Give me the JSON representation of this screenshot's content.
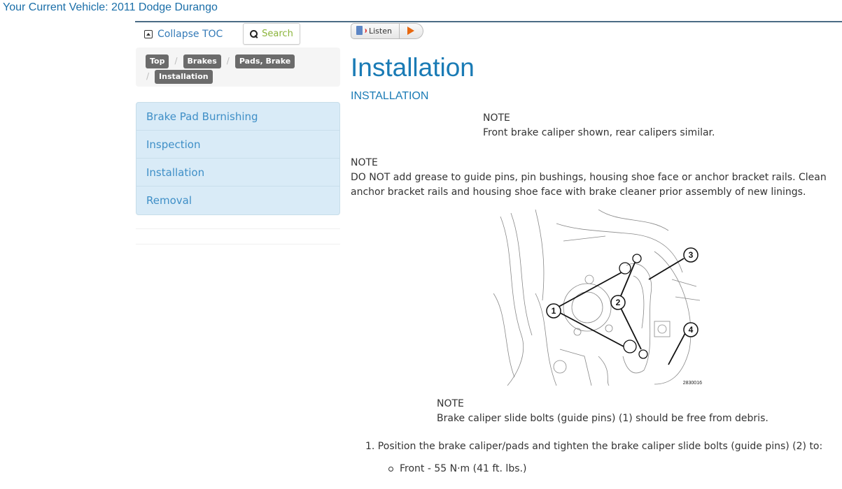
{
  "header": {
    "vehicle_title": "Your Current Vehicle: 2011 Dodge Durango"
  },
  "sidebar": {
    "collapse_toc_label": "Collapse TOC",
    "search_label": "Search",
    "breadcrumb": [
      {
        "label": "Top"
      },
      {
        "label": "Brakes"
      },
      {
        "label": "Pads, Brake"
      },
      {
        "label": "Installation"
      }
    ],
    "breadcrumb_separator": "/",
    "toc_items": [
      {
        "label": "Brake Pad Burnishing"
      },
      {
        "label": "Inspection"
      },
      {
        "label": "Installation"
      },
      {
        "label": "Removal"
      }
    ]
  },
  "main": {
    "listen_label": "Listen",
    "page_title": "Installation",
    "section_title": "INSTALLATION",
    "notes": [
      {
        "heading": "NOTE",
        "text": "Front brake caliper shown, rear calipers similar."
      },
      {
        "heading": "NOTE",
        "text": "DO NOT add grease to guide pins, pin bushings, housing shoe face or anchor bracket rails. Clean anchor bracket rails and housing shoe face with brake cleaner prior assembly of new linings."
      },
      {
        "heading": "NOTE",
        "text": "Brake caliper slide bolts (guide pins) (1) should be free from debris."
      }
    ],
    "figure": {
      "id_label": "2830016",
      "callouts": [
        "1",
        "2",
        "3",
        "4"
      ]
    },
    "steps": [
      {
        "text": "1. Position the brake caliper/pads and tighten the brake caliper slide bolts (guide pins) (2) to:",
        "substeps": [
          "Front - 55 N·m (41 ft. lbs.)"
        ]
      }
    ]
  },
  "colors": {
    "link_blue": "#1a7bb5",
    "toc_bg": "#d9ebf7",
    "search_green": "#8bb43a",
    "crumb_bg": "#6b6b6b",
    "play_orange": "#e8680f"
  }
}
